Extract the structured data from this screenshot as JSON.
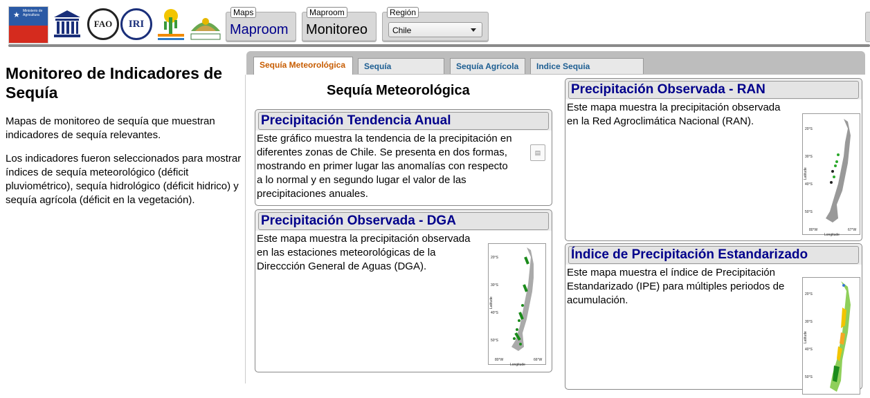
{
  "header": {
    "logos": [
      {
        "name": "Ministerio de Agricultura",
        "icon": "ministerio-agricultura-logo"
      },
      {
        "name": "UNESCO",
        "icon": "unesco-logo"
      },
      {
        "name": "FAO",
        "icon": "fao-logo"
      },
      {
        "name": "IRI",
        "icon": "iri-logo"
      },
      {
        "name": "CAZALAC",
        "icon": "cazalac-logo"
      },
      {
        "name": "CEAZA",
        "icon": "ceaza-logo"
      }
    ],
    "chile_logo_text": "Ministerio de Agricultura",
    "fao_text": "FAO",
    "iri_text": "IRI",
    "maps": {
      "legend": "Maps",
      "value": "Maproom"
    },
    "maproom": {
      "legend": "Maproom",
      "value": "Monitoreo"
    },
    "region": {
      "legend": "Región",
      "value": "Chile"
    }
  },
  "sidebar": {
    "title": "Monitoreo de Indicadores de Sequía",
    "paragraphs": [
      "Mapas de monitoreo de sequía que muestran indicadores de sequía relevantes.",
      "Los indicadores fueron seleccionados para mostrar índices de sequía meteorológico (déficit pluviométrico), sequía hidrológico (déficit hidrico) y sequía agrícola (déficit en la vegetación)."
    ]
  },
  "tabs": [
    {
      "label": "Sequía Meteorológica",
      "active": true
    },
    {
      "label": "Sequía Hidrológica",
      "active": false
    },
    {
      "label": "Sequía Agrícola",
      "active": false
    },
    {
      "label": "Indice Sequia Combinado",
      "active": false
    }
  ],
  "main": {
    "section_title": "Sequía Meteorológica",
    "cards": [
      {
        "title": "Precipitación Tendencia Anual",
        "lines": [
          "Este gráfico muestra la tendencia de la precipitación en",
          "diferentes zonas de Chile. Se presenta en dos formas,",
          "mostrando en primer lugar las anomalías con respecto",
          "a lo normal y en segundo lugar el valor de las",
          "precipitaciones anuales."
        ]
      },
      {
        "title": "Precipitación Observada - DGA",
        "lines": [
          "Este mapa muestra la precipitación observada",
          "en las estaciones meteorológicas de la",
          "Direccción General de Aguas (DGA)."
        ],
        "map": {
          "lat_labels": [
            "20°S",
            "30°S",
            "40°S",
            "50°S"
          ],
          "lon_labels": [
            "80°W",
            "66°W"
          ],
          "xlabel": "Longitude",
          "ylabel": "Latitude"
        }
      },
      {
        "title": "Precipitación Observada - RAN",
        "lines": [
          "Este mapa muestra la precipitación observada",
          "en la Red Agroclimática Nacional (RAN)."
        ],
        "map": {
          "lat_labels": [
            "20°S",
            "30°S",
            "40°S",
            "50°S"
          ],
          "lon_labels": [
            "80°W",
            "67°W"
          ],
          "xlabel": "Longitude",
          "ylabel": "Latitude"
        }
      },
      {
        "title": "Índice de Precipitación Estandarizado",
        "lines": [
          "Este mapa muestra el índice de Precipitación",
          "Estandarizado (IPE) para múltiples periodos de",
          "acumulación."
        ],
        "map": {
          "lat_labels": [
            "20°S",
            "30°S",
            "40°S",
            "50°S"
          ],
          "xlabel": "",
          "ylabel": "Latitude"
        }
      }
    ]
  },
  "colors": {
    "link": "#00008b",
    "active_tab": "#c75c00",
    "tab": "#1d5e92"
  }
}
